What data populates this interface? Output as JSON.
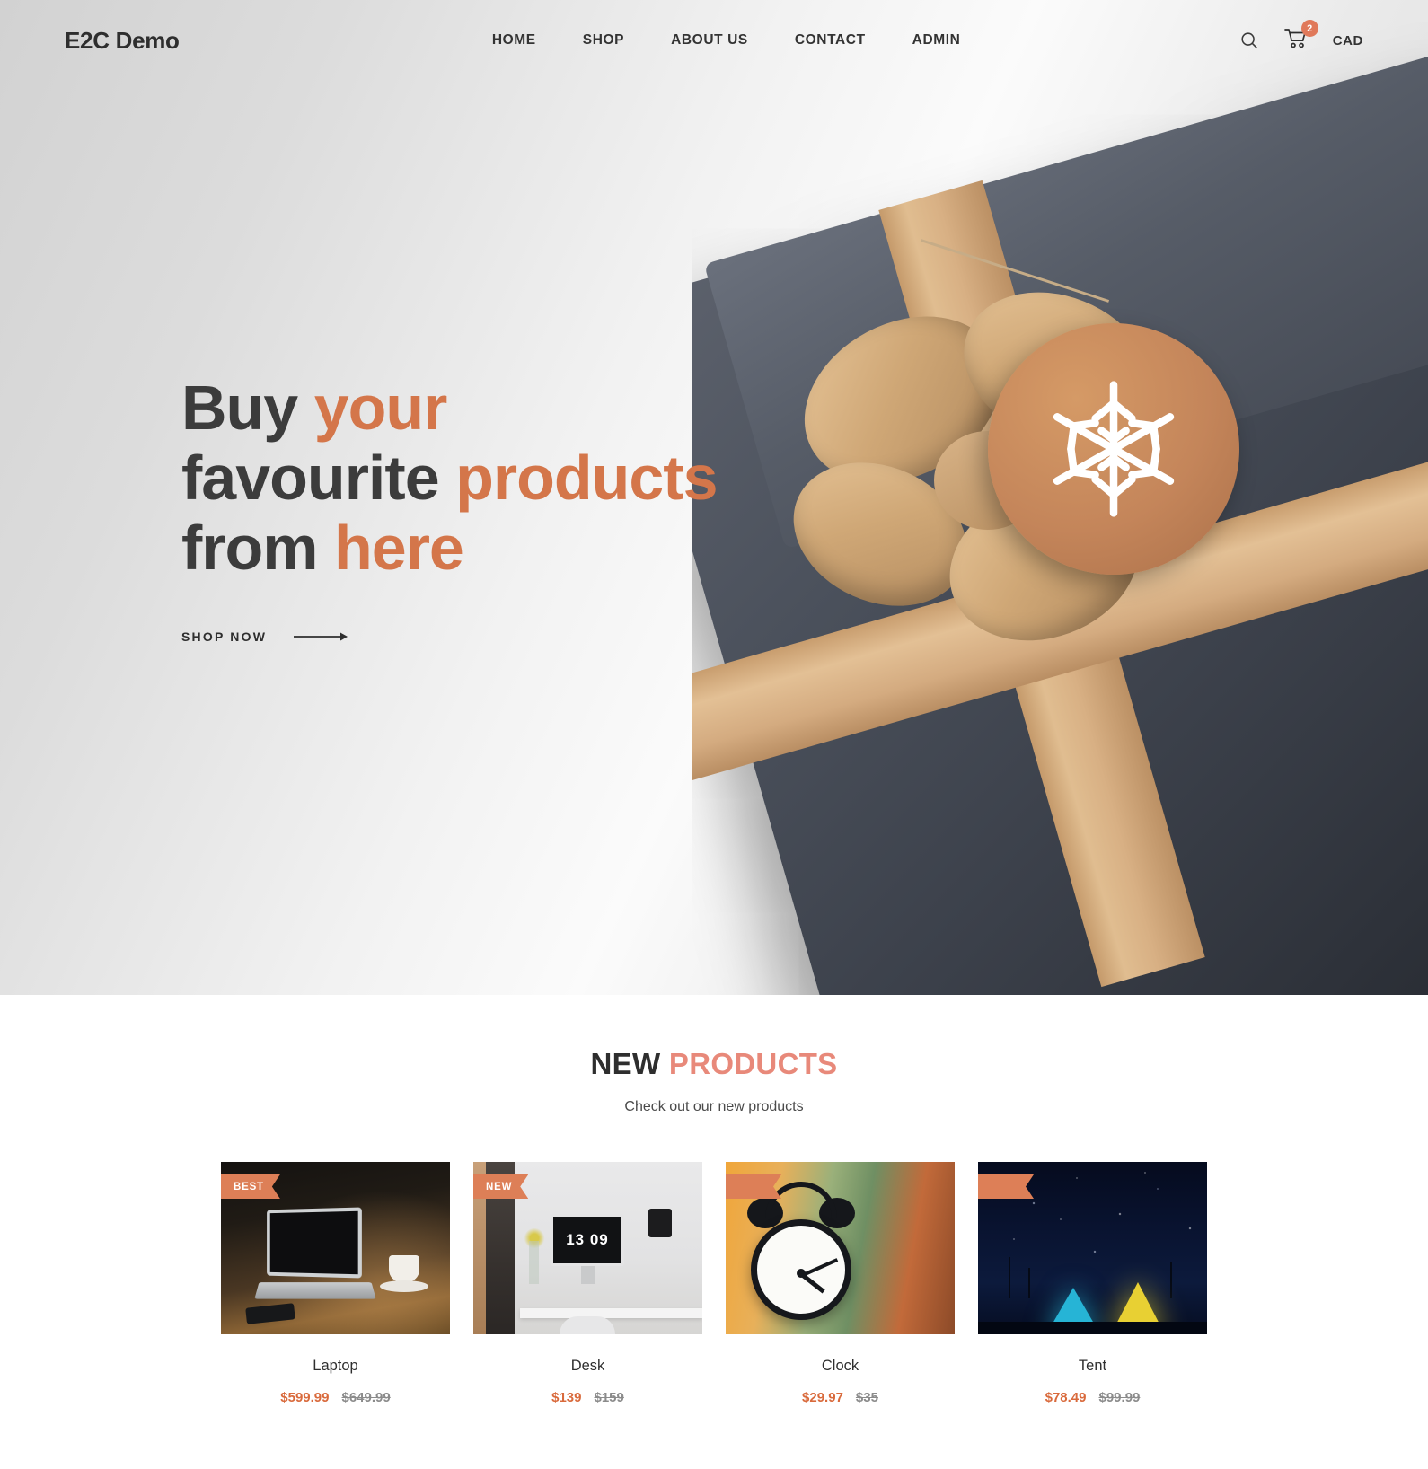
{
  "header": {
    "logo": "E2C Demo",
    "nav": [
      {
        "label": "HOME"
      },
      {
        "label": "SHOP"
      },
      {
        "label": "ABOUT US"
      },
      {
        "label": "CONTACT"
      },
      {
        "label": "ADMIN"
      }
    ],
    "search_icon": "search-icon",
    "cart_icon": "cart-icon",
    "cart_count": "2",
    "currency": "CAD"
  },
  "hero": {
    "line1_dark": "Buy ",
    "line1_accent": "your",
    "line2_dark": "favourite ",
    "line2_accent": "products",
    "line3_dark": "from ",
    "line3_accent": "here",
    "cta_label": "SHOP NOW",
    "cta_icon": "arrow-right-icon"
  },
  "products_section": {
    "title_dark": "NEW",
    "title_accent": "PRODUCTS",
    "subtitle": "Check out our new products",
    "items": [
      {
        "badge": "BEST",
        "name": "Laptop",
        "price_new": "$599.99",
        "price_old": "$649.99",
        "image": "laptop-on-wooden-desk-photo"
      },
      {
        "badge": "NEW",
        "name": "Desk",
        "price_new": "$139",
        "price_old": "$159",
        "image": "office-desk-workspace-photo",
        "screen_text": "13 09"
      },
      {
        "badge": "",
        "name": "Clock",
        "price_new": "$29.97",
        "price_old": "$35",
        "image": "alarm-clock-photo"
      },
      {
        "badge": "",
        "name": "Tent",
        "price_new": "$78.49",
        "price_old": "$99.99",
        "image": "illuminated-tents-night-sky-photo"
      }
    ]
  },
  "colors": {
    "accent": "#d4764a",
    "badge": "#dd7f57",
    "price_new": "#d96a3c",
    "title_accent": "#e8897a"
  }
}
